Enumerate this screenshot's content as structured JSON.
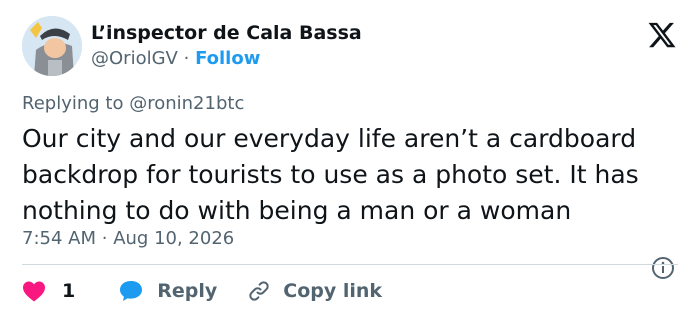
{
  "author": {
    "display_name": "L’inspector de Cala Bassa",
    "handle": "@OriolGV",
    "separator": "·",
    "follow_label": "Follow"
  },
  "reply_context": {
    "prefix": "Replying to",
    "mention": "@ronin21btc"
  },
  "tweet": {
    "lines": [
      "Our city and our everyday life aren’t a cardboard",
      "backdrop for tourists to use as a photo set. It has",
      "nothing to do with being a man or a woman"
    ],
    "time": "7:54 AM",
    "separator": "·",
    "date": "Aug 10, 2026"
  },
  "actions": {
    "like_count": "1",
    "reply_label": "Reply",
    "copy_link_label": "Copy link"
  },
  "colors": {
    "accent": "#1d9bf0",
    "like": "#f91880",
    "text": "#0f1419",
    "muted": "#536471",
    "divider": "#cfd9de"
  },
  "icons": [
    "avatar",
    "x-logo-icon",
    "info-icon",
    "heart-icon",
    "reply-bubble-icon",
    "link-icon"
  ]
}
